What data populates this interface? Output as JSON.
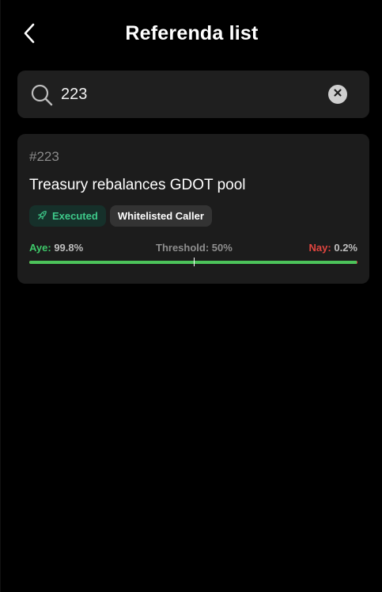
{
  "header": {
    "title": "Referenda list",
    "back_icon": "chevron-left-icon"
  },
  "search": {
    "value": "223",
    "placeholder": "",
    "icon": "search-icon",
    "clear_icon": "clear-icon"
  },
  "referenda": [
    {
      "id": "#223",
      "title": "Treasury rebalances GDOT pool",
      "status": {
        "label": "Executed",
        "icon": "rocket-icon",
        "color": "#3ec98a"
      },
      "track": "Whitelisted Caller",
      "votes": {
        "aye_label": "Aye:",
        "aye_value": "99.8%",
        "aye_fraction": 0.998,
        "threshold_label": "Threshold:",
        "threshold_value": "50%",
        "threshold_fraction": 0.5,
        "nay_label": "Nay:",
        "nay_value": "0.2%"
      }
    }
  ],
  "colors": {
    "background": "#000000",
    "card": "#1c1c1c",
    "aye": "#3ec96a",
    "nay": "#e0453f",
    "executed": "#3ec98a"
  }
}
